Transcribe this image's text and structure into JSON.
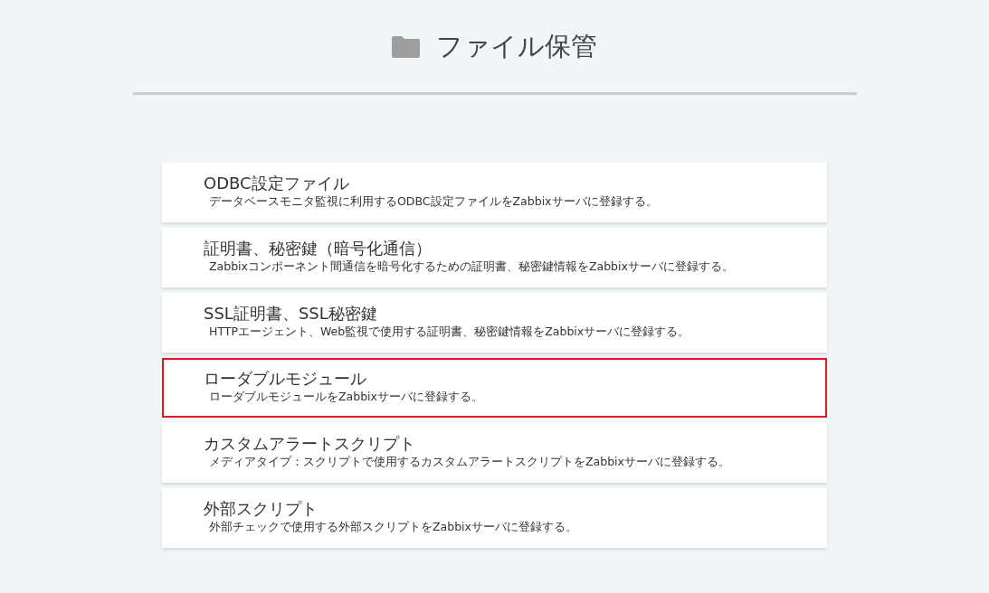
{
  "header": {
    "title": "ファイル保管"
  },
  "items": [
    {
      "title": "ODBC設定ファイル",
      "description": "データベースモニタ監視に利用するODBC設定ファイルをZabbixサーバに登録する。",
      "selected": false
    },
    {
      "title": "証明書、秘密鍵（暗号化通信）",
      "description": "Zabbixコンポーネント間通信を暗号化するための証明書、秘密鍵情報をZabbixサーバに登録する。",
      "selected": false
    },
    {
      "title": "SSL証明書、SSL秘密鍵",
      "description": "HTTPエージェント、Web監視で使用する証明書、秘密鍵情報をZabbixサーバに登録する。",
      "selected": false
    },
    {
      "title": "ローダブルモジュール",
      "description": "ローダブルモジュールをZabbixサーバに登録する。",
      "selected": true
    },
    {
      "title": "カスタムアラートスクリプト",
      "description": "メディアタイプ：スクリプトで使用するカスタムアラートスクリプトをZabbixサーバに登録する。",
      "selected": false
    },
    {
      "title": "外部スクリプト",
      "description": "外部チェックで使用する外部スクリプトをZabbixサーバに登録する。",
      "selected": false
    }
  ]
}
